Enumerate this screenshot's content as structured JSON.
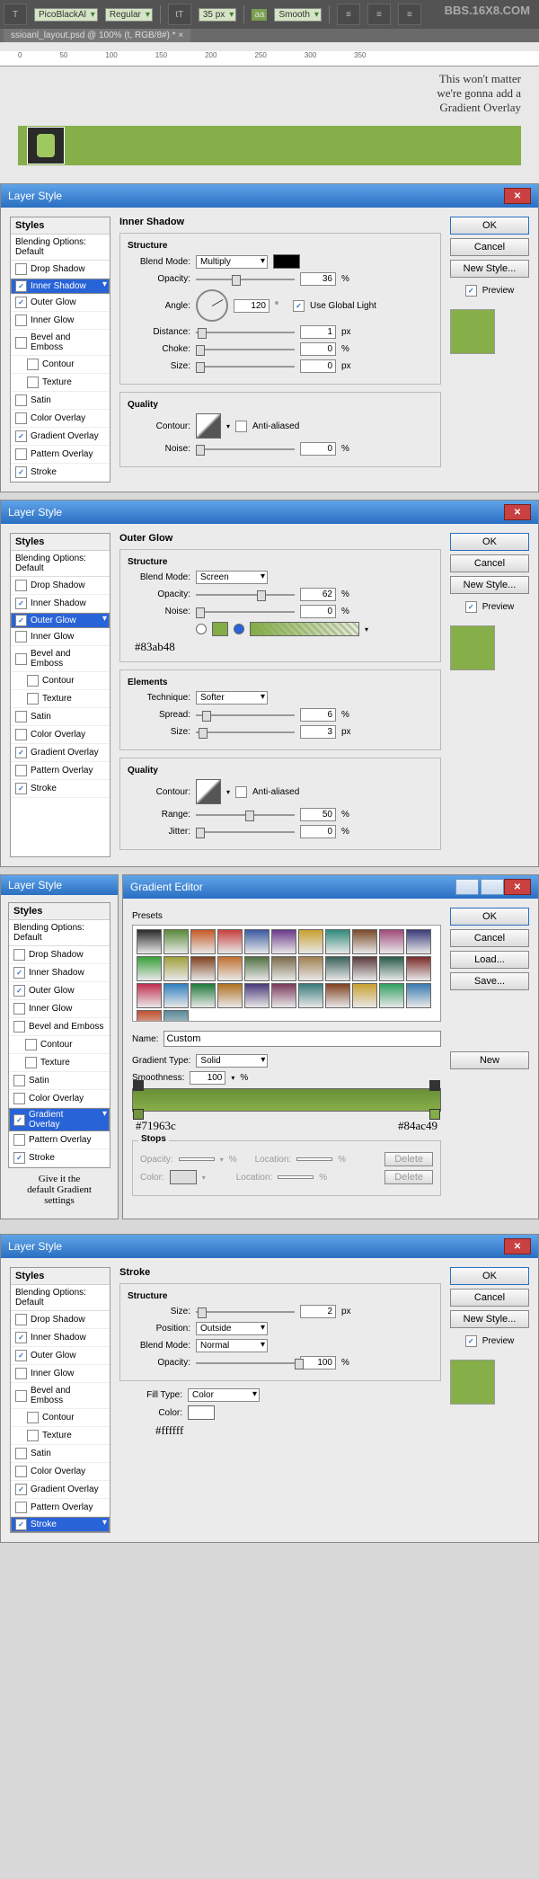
{
  "toolbar": {
    "font": "PicoBlackAl",
    "weight": "Regular",
    "size": "35 px",
    "aa_label": "aa",
    "smooth": "Smooth"
  },
  "tab": "ssioanl_layout.psd @ 100% (t, RGB/8#) * ×",
  "ruler_marks": [
    "0",
    "50",
    "100",
    "150",
    "200",
    "250",
    "300",
    "350"
  ],
  "annotation": "This won't matter\nwe're gonna add a\nGradient Overlay",
  "watermark": "BBS.16X8.COM",
  "dlg_title": "Layer Style",
  "styles_hd": "Styles",
  "blending_opts": "Blending Options: Default",
  "style_items": [
    "Drop Shadow",
    "Inner Shadow",
    "Outer Glow",
    "Inner Glow",
    "Bevel and Emboss",
    "Contour",
    "Texture",
    "Satin",
    "Color Overlay",
    "Gradient Overlay",
    "Pattern Overlay",
    "Stroke"
  ],
  "btns": {
    "ok": "OK",
    "cancel": "Cancel",
    "newstyle": "New Style...",
    "preview": "Preview",
    "load": "Load...",
    "save": "Save...",
    "new": "New",
    "delete": "Delete"
  },
  "inner_shadow": {
    "title": "Inner Shadow",
    "structure": "Structure",
    "quality": "Quality",
    "blend_mode_lbl": "Blend Mode:",
    "blend_mode": "Multiply",
    "opacity_lbl": "Opacity:",
    "opacity": "36",
    "pct": "%",
    "angle_lbl": "Angle:",
    "angle": "120",
    "deg": "°",
    "global": "Use Global Light",
    "distance_lbl": "Distance:",
    "distance": "1",
    "px": "px",
    "choke_lbl": "Choke:",
    "choke": "0",
    "size_lbl": "Size:",
    "size": "0",
    "contour_lbl": "Contour:",
    "anti": "Anti-aliased",
    "noise_lbl": "Noise:",
    "noise": "0"
  },
  "outer_glow": {
    "title": "Outer Glow",
    "structure": "Structure",
    "elements": "Elements",
    "quality": "Quality",
    "blend_mode_lbl": "Blend Mode:",
    "blend_mode": "Screen",
    "opacity_lbl": "Opacity:",
    "opacity": "62",
    "pct": "%",
    "noise_lbl": "Noise:",
    "noise": "0",
    "hex": "#83ab48",
    "technique_lbl": "Technique:",
    "technique": "Softer",
    "spread_lbl": "Spread:",
    "spread": "6",
    "size_lbl": "Size:",
    "size": "3",
    "px": "px",
    "contour_lbl": "Contour:",
    "anti": "Anti-aliased",
    "range_lbl": "Range:",
    "range": "50",
    "jitter_lbl": "Jitter:",
    "jitter": "0"
  },
  "gradient_editor": {
    "title": "Gradient Editor",
    "presets": "Presets",
    "name_lbl": "Name:",
    "name": "Custom",
    "type_lbl": "Gradient Type:",
    "type": "Solid",
    "smooth_lbl": "Smoothness:",
    "smooth": "100",
    "pct": "%",
    "stops": "Stops",
    "opacity_lbl": "Opacity:",
    "location_lbl": "Location:",
    "color_lbl": "Color:",
    "hex_left": "#71963c",
    "hex_right": "#84ac49",
    "preset_colors": [
      "#2a2a2a",
      "#5a8a3a",
      "#c45a26",
      "#c94040",
      "#3a5aa0",
      "#6a3a8a",
      "#c8a030",
      "#308a7a",
      "#7a4a2a",
      "#a04a7a",
      "#3a3a7a",
      "#3aa03a",
      "#a0a03a",
      "#804020",
      "#c07030",
      "#507040",
      "#7a6a4a",
      "#a08050",
      "#3a605a",
      "#5a3a3a",
      "#2a5a4a",
      "#7a2a2a",
      "#c03050",
      "#3080c0",
      "#207a3a",
      "#b07020",
      "#4a3a7a",
      "#7a3a5a",
      "#3a7a7a",
      "#804020",
      "#c8a030",
      "#30a060",
      "#3a7ab0",
      "#c05030",
      "#5a8a9a"
    ]
  },
  "gradient_note": "Give it the\ndefault Gradient\nsettings",
  "stroke": {
    "title": "Stroke",
    "structure": "Structure",
    "size_lbl": "Size:",
    "size": "2",
    "px": "px",
    "position_lbl": "Position:",
    "position": "Outside",
    "blend_mode_lbl": "Blend Mode:",
    "blend_mode": "Normal",
    "opacity_lbl": "Opacity:",
    "opacity": "100",
    "pct": "%",
    "fill_lbl": "Fill Type:",
    "fill": "Color",
    "color_lbl": "Color:",
    "hex": "#ffffff"
  }
}
